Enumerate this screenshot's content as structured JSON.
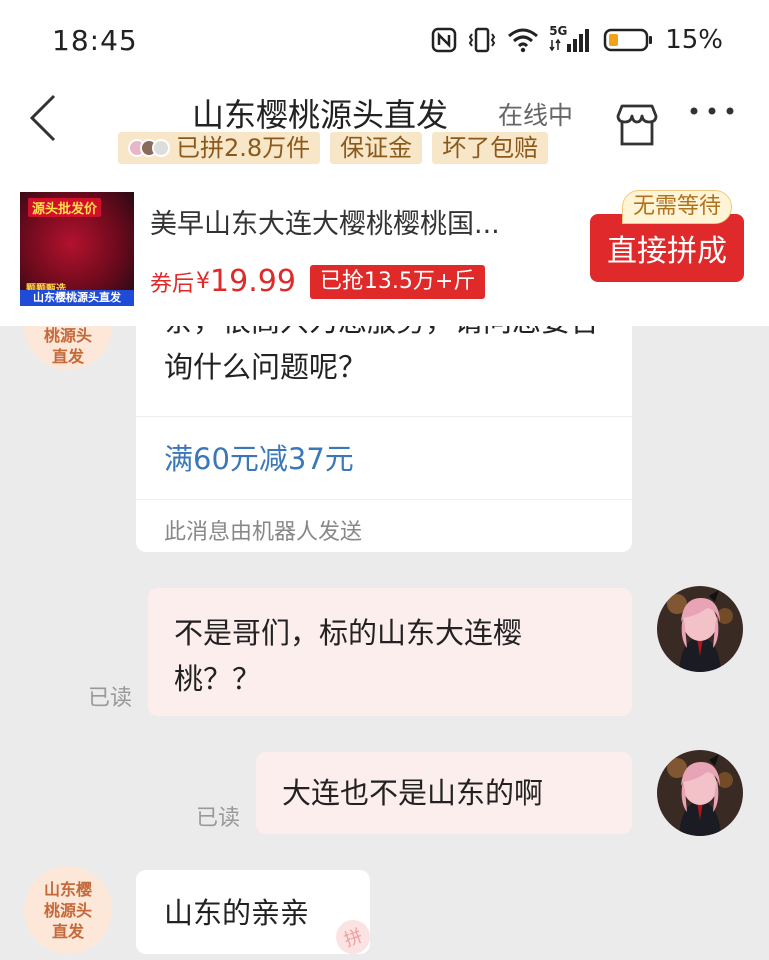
{
  "status_bar": {
    "time": "18:45",
    "network": "5G",
    "battery_percent": "15%",
    "battery_level": 0.15,
    "icons": [
      "nfc-icon",
      "vibrate-icon",
      "wifi-icon",
      "signal-icon",
      "battery-icon"
    ]
  },
  "header": {
    "shop_name": "山东樱桃源头直发",
    "online_status": "在线中",
    "badges": [
      "已拼2.8万件",
      "保证金",
      "坏了包赔"
    ],
    "icons": [
      "back-icon",
      "store-icon",
      "more-icon"
    ]
  },
  "product": {
    "thumb_top": "源头批发价",
    "thumb_mid": "颗颗甄选",
    "thumb_bottom": "山东樱桃源头直发",
    "title": "美早山东大连大樱桃樱桃国...",
    "price_label": "券后",
    "price_currency": "¥",
    "price_value": "19.99",
    "sold_tag": "已抢13.5万+斤",
    "buy_button": "直接拼成",
    "no_wait_badge": "无需等待"
  },
  "chat": {
    "shop_avatar_text": "山东樱桃源头直发",
    "shop_avatar_partial": "桃源头直发",
    "messages": [
      {
        "sender": "shop",
        "text": "亲，很高兴为您服务，请问您要咨询什么问题呢？",
        "coupon_link": "满60元减37元",
        "note": "此消息由机器人发送"
      },
      {
        "sender": "me",
        "text": "不是哥们，标的山东大连樱桃？？",
        "status": "已读"
      },
      {
        "sender": "me",
        "text": "大连也不是山东的啊",
        "status": "已读"
      },
      {
        "sender": "shop",
        "text": "山东的亲亲"
      }
    ]
  },
  "colors": {
    "accent_red": "#e0292a",
    "my_bubble": "#fdeeee",
    "link_blue": "#3b78b7",
    "badge_bg": "#f8e6c8"
  }
}
